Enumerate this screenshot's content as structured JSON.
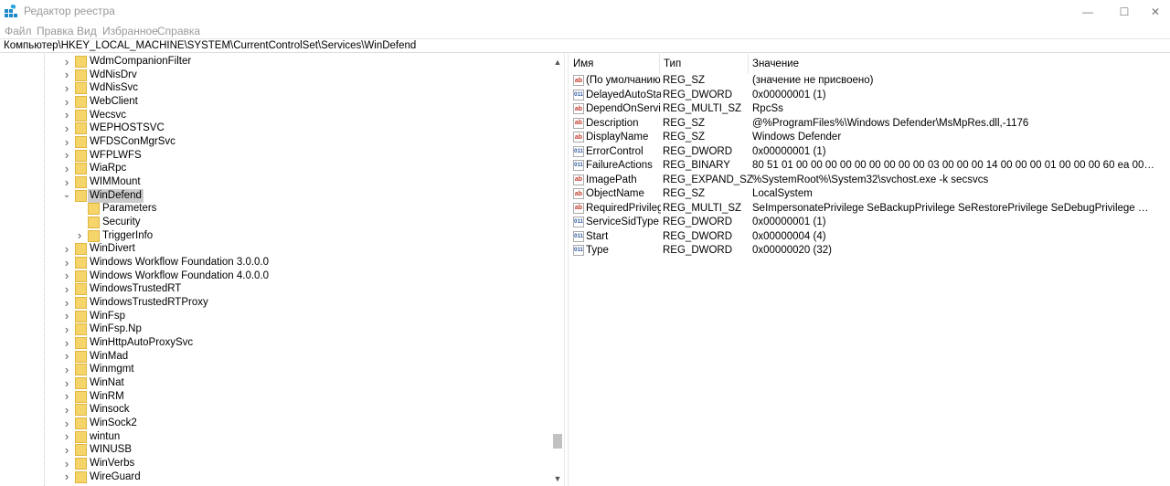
{
  "window": {
    "title": "Редактор реестра",
    "icons": {
      "app": "registry-editor-icon",
      "min": "minimize-icon",
      "max": "maximize-icon",
      "close": "close-icon"
    },
    "min_glyph": "—",
    "max_glyph": "☐",
    "close_glyph": "✕"
  },
  "menu": {
    "file": "Файл",
    "edit": "Правка",
    "view": "Вид",
    "favorites": "Избранное",
    "help": "Справка"
  },
  "address": "Компьютер\\HKEY_LOCAL_MACHINE\\SYSTEM\\CurrentControlSet\\Services\\WinDefend",
  "tree": {
    "expander_collapsed": "›",
    "expander_expanded": "⌄",
    "items": [
      {
        "label": "WdmCompanionFilter",
        "level": 1,
        "state": "collapsed"
      },
      {
        "label": "WdNisDrv",
        "level": 1,
        "state": "collapsed"
      },
      {
        "label": "WdNisSvc",
        "level": 1,
        "state": "collapsed"
      },
      {
        "label": "WebClient",
        "level": 1,
        "state": "collapsed"
      },
      {
        "label": "Wecsvc",
        "level": 1,
        "state": "collapsed"
      },
      {
        "label": "WEPHOSTSVC",
        "level": 1,
        "state": "collapsed"
      },
      {
        "label": "WFDSConMgrSvc",
        "level": 1,
        "state": "collapsed"
      },
      {
        "label": "WFPLWFS",
        "level": 1,
        "state": "collapsed"
      },
      {
        "label": "WiaRpc",
        "level": 1,
        "state": "collapsed"
      },
      {
        "label": "WIMMount",
        "level": 1,
        "state": "collapsed"
      },
      {
        "label": "WinDefend",
        "level": 1,
        "state": "expanded",
        "selected": true
      },
      {
        "label": "Parameters",
        "level": 2,
        "state": "none"
      },
      {
        "label": "Security",
        "level": 2,
        "state": "none"
      },
      {
        "label": "TriggerInfo",
        "level": 2,
        "state": "collapsed"
      },
      {
        "label": "WinDivert",
        "level": 1,
        "state": "collapsed"
      },
      {
        "label": "Windows Workflow Foundation 3.0.0.0",
        "level": 1,
        "state": "collapsed"
      },
      {
        "label": "Windows Workflow Foundation 4.0.0.0",
        "level": 1,
        "state": "collapsed"
      },
      {
        "label": "WindowsTrustedRT",
        "level": 1,
        "state": "collapsed"
      },
      {
        "label": "WindowsTrustedRTProxy",
        "level": 1,
        "state": "collapsed"
      },
      {
        "label": "WinFsp",
        "level": 1,
        "state": "collapsed"
      },
      {
        "label": "WinFsp.Np",
        "level": 1,
        "state": "collapsed"
      },
      {
        "label": "WinHttpAutoProxySvc",
        "level": 1,
        "state": "collapsed"
      },
      {
        "label": "WinMad",
        "level": 1,
        "state": "collapsed"
      },
      {
        "label": "Winmgmt",
        "level": 1,
        "state": "collapsed"
      },
      {
        "label": "WinNat",
        "level": 1,
        "state": "collapsed"
      },
      {
        "label": "WinRM",
        "level": 1,
        "state": "collapsed"
      },
      {
        "label": "Winsock",
        "level": 1,
        "state": "collapsed"
      },
      {
        "label": "WinSock2",
        "level": 1,
        "state": "collapsed"
      },
      {
        "label": "wintun",
        "level": 1,
        "state": "collapsed"
      },
      {
        "label": "WINUSB",
        "level": 1,
        "state": "collapsed"
      },
      {
        "label": "WinVerbs",
        "level": 1,
        "state": "collapsed"
      },
      {
        "label": "WireGuard",
        "level": 1,
        "state": "collapsed"
      }
    ]
  },
  "scrollbar": {
    "up_glyph": "▲",
    "down_glyph": "▼"
  },
  "values": {
    "headers": {
      "name": "Имя",
      "type": "Тип",
      "data": "Значение"
    },
    "rows": [
      {
        "icon": "sz",
        "icon_text": "ab",
        "name": "(По умолчанию)",
        "type": "REG_SZ",
        "data": "(значение не присвоено)"
      },
      {
        "icon": "bin",
        "icon_text": "011",
        "name": "DelayedAutoStart",
        "type": "REG_DWORD",
        "data": "0x00000001 (1)"
      },
      {
        "icon": "sz",
        "icon_text": "ab",
        "name": "DependOnService",
        "type": "REG_MULTI_SZ",
        "data": "RpcSs"
      },
      {
        "icon": "sz",
        "icon_text": "ab",
        "name": "Description",
        "type": "REG_SZ",
        "data": "@%ProgramFiles%\\Windows Defender\\MsMpRes.dll,-1176"
      },
      {
        "icon": "sz",
        "icon_text": "ab",
        "name": "DisplayName",
        "type": "REG_SZ",
        "data": "Windows Defender"
      },
      {
        "icon": "bin",
        "icon_text": "011",
        "name": "ErrorControl",
        "type": "REG_DWORD",
        "data": "0x00000001 (1)"
      },
      {
        "icon": "bin",
        "icon_text": "011",
        "name": "FailureActions",
        "type": "REG_BINARY",
        "data": "80 51 01 00 00 00 00 00 00 00 00 00 03 00 00 00 14 00 00 00 01 00 00 00 60 ea 00 00 01 00 00 00 60 ea ..."
      },
      {
        "icon": "sz",
        "icon_text": "ab",
        "name": "ImagePath",
        "type": "REG_EXPAND_SZ",
        "data": "%SystemRoot%\\System32\\svchost.exe -k secsvcs"
      },
      {
        "icon": "sz",
        "icon_text": "ab",
        "name": "ObjectName",
        "type": "REG_SZ",
        "data": "LocalSystem"
      },
      {
        "icon": "sz",
        "icon_text": "ab",
        "name": "RequiredPrivileg...",
        "type": "REG_MULTI_SZ",
        "data": "SeImpersonatePrivilege SeBackupPrivilege SeRestorePrivilege SeDebugPrivilege SeChangeNotifyP..."
      },
      {
        "icon": "bin",
        "icon_text": "011",
        "name": "ServiceSidType",
        "type": "REG_DWORD",
        "data": "0x00000001 (1)"
      },
      {
        "icon": "bin",
        "icon_text": "011",
        "name": "Start",
        "type": "REG_DWORD",
        "data": "0x00000004 (4)"
      },
      {
        "icon": "bin",
        "icon_text": "011",
        "name": "Type",
        "type": "REG_DWORD",
        "data": "0x00000020 (32)"
      }
    ]
  },
  "colors": {
    "folder": "#f5d469",
    "folder_edge": "#e1b53d",
    "selected": "#cccccc",
    "app_icon": "#1e88c8"
  }
}
